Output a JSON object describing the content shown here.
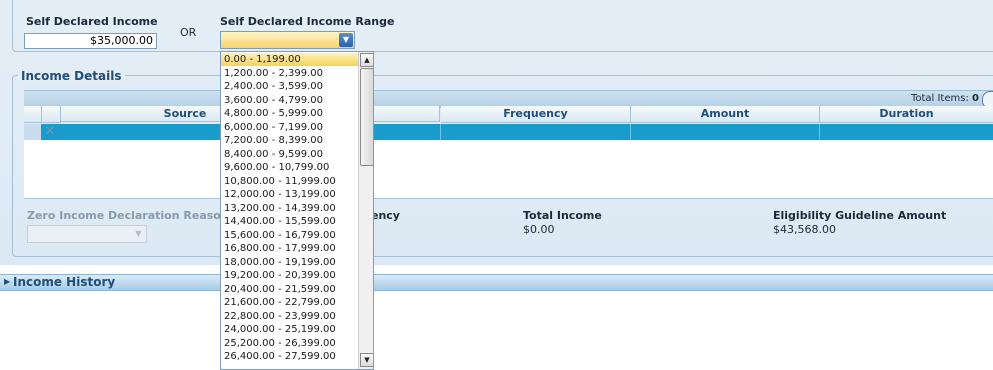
{
  "self_declared_income": {
    "label": "Self Declared Income",
    "value": "$35,000.00"
  },
  "or_label": "OR",
  "self_declared_income_range": {
    "label": "Self Declared Income Range",
    "selected": "",
    "options": [
      "0.00 - 1,199.00",
      "1,200.00 - 2,399.00",
      "2,400.00 - 3,599.00",
      "3,600.00 - 4,799.00",
      "4,800.00 - 5,999.00",
      "6,000.00 - 7,199.00",
      "7,200.00 - 8,399.00",
      "8,400.00 - 9,599.00",
      "9,600.00 - 10,799.00",
      "10,800.00 - 11,999.00",
      "12,000.00 - 13,199.00",
      "13,200.00 - 14,399.00",
      "14,400.00 - 15,599.00",
      "15,600.00 - 16,799.00",
      "16,800.00 - 17,999.00",
      "18,000.00 - 19,199.00",
      "19,200.00 - 20,399.00",
      "20,400.00 - 21,599.00",
      "21,600.00 - 22,799.00",
      "22,800.00 - 23,999.00",
      "24,000.00 - 25,199.00",
      "25,200.00 - 26,399.00",
      "26,400.00 - 27,599.00"
    ],
    "highlighted_index": 0
  },
  "income_details": {
    "legend": "Income Details",
    "total_items_label": "Total Items:",
    "total_items_value": "0",
    "columns": [
      "Source",
      "Frequency",
      "Amount",
      "Duration"
    ],
    "frequency_partial": "ency"
  },
  "zero_income_label": "Zero Income Declaration Reason",
  "total_income": {
    "label": "Total Income",
    "value": "$0.00"
  },
  "eligibility": {
    "label": "Eligibility Guideline Amount",
    "value": "$43,568.00"
  },
  "income_history": {
    "label": "Income History"
  },
  "icons": {
    "dropdown_arrow": "▼",
    "delete": "✕",
    "expand": "▶",
    "scroll_up": "▲",
    "scroll_down": "▼"
  },
  "colors": {
    "accent": "#199bcc",
    "highlight": "#f6d15f",
    "header_text": "#1f4e79"
  }
}
